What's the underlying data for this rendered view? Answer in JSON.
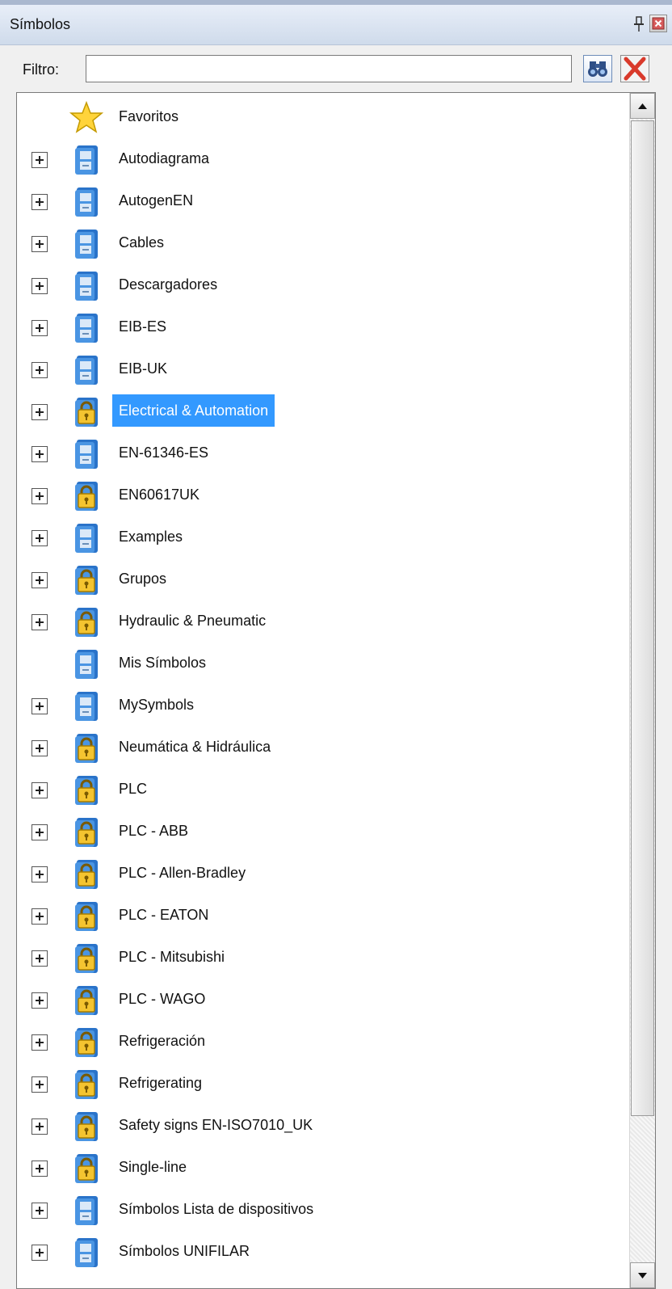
{
  "window": {
    "title": "Símbolos"
  },
  "filter": {
    "label": "Filtro:",
    "value": "",
    "placeholder": ""
  },
  "icons": {
    "pin": "pin-icon",
    "close": "close-icon",
    "search": "binoculars-icon",
    "clear": "red-x-icon",
    "favorite": "star-icon",
    "library": "library-icon",
    "locked": "locked-library-icon",
    "expand": "plus-icon"
  },
  "colors": {
    "selection": "#3399ff",
    "titlebar": "#cfdbeb"
  },
  "tree": {
    "items": [
      {
        "label": "Favoritos",
        "icon": "star",
        "expandable": false,
        "selected": false
      },
      {
        "label": "Autodiagrama",
        "icon": "library",
        "expandable": true,
        "selected": false
      },
      {
        "label": "AutogenEN",
        "icon": "library",
        "expandable": true,
        "selected": false
      },
      {
        "label": "Cables",
        "icon": "library",
        "expandable": true,
        "selected": false
      },
      {
        "label": "Descargadores",
        "icon": "library",
        "expandable": true,
        "selected": false
      },
      {
        "label": "EIB-ES",
        "icon": "library",
        "expandable": true,
        "selected": false
      },
      {
        "label": "EIB-UK",
        "icon": "library",
        "expandable": true,
        "selected": false
      },
      {
        "label": "Electrical & Automation",
        "icon": "locked",
        "expandable": true,
        "selected": true
      },
      {
        "label": "EN-61346-ES",
        "icon": "library",
        "expandable": true,
        "selected": false
      },
      {
        "label": "EN60617UK",
        "icon": "locked",
        "expandable": true,
        "selected": false
      },
      {
        "label": "Examples",
        "icon": "library",
        "expandable": true,
        "selected": false
      },
      {
        "label": "Grupos",
        "icon": "locked",
        "expandable": true,
        "selected": false
      },
      {
        "label": "Hydraulic & Pneumatic",
        "icon": "locked",
        "expandable": true,
        "selected": false
      },
      {
        "label": "Mis Símbolos",
        "icon": "library",
        "expandable": false,
        "selected": false
      },
      {
        "label": "MySymbols",
        "icon": "library",
        "expandable": true,
        "selected": false
      },
      {
        "label": "Neumática & Hidráulica",
        "icon": "locked",
        "expandable": true,
        "selected": false
      },
      {
        "label": "PLC",
        "icon": "locked",
        "expandable": true,
        "selected": false
      },
      {
        "label": "PLC - ABB",
        "icon": "locked",
        "expandable": true,
        "selected": false
      },
      {
        "label": "PLC - Allen-Bradley",
        "icon": "locked",
        "expandable": true,
        "selected": false
      },
      {
        "label": "PLC - EATON",
        "icon": "locked",
        "expandable": true,
        "selected": false
      },
      {
        "label": "PLC - Mitsubishi",
        "icon": "locked",
        "expandable": true,
        "selected": false
      },
      {
        "label": "PLC - WAGO",
        "icon": "locked",
        "expandable": true,
        "selected": false
      },
      {
        "label": "Refrigeración",
        "icon": "locked",
        "expandable": true,
        "selected": false
      },
      {
        "label": "Refrigerating",
        "icon": "locked",
        "expandable": true,
        "selected": false
      },
      {
        "label": "Safety signs EN-ISO7010_UK",
        "icon": "locked",
        "expandable": true,
        "selected": false
      },
      {
        "label": "Single-line",
        "icon": "locked",
        "expandable": true,
        "selected": false
      },
      {
        "label": "Símbolos Lista de dispositivos",
        "icon": "library",
        "expandable": true,
        "selected": false
      },
      {
        "label": "Símbolos UNIFILAR",
        "icon": "library",
        "expandable": true,
        "selected": false
      }
    ]
  }
}
